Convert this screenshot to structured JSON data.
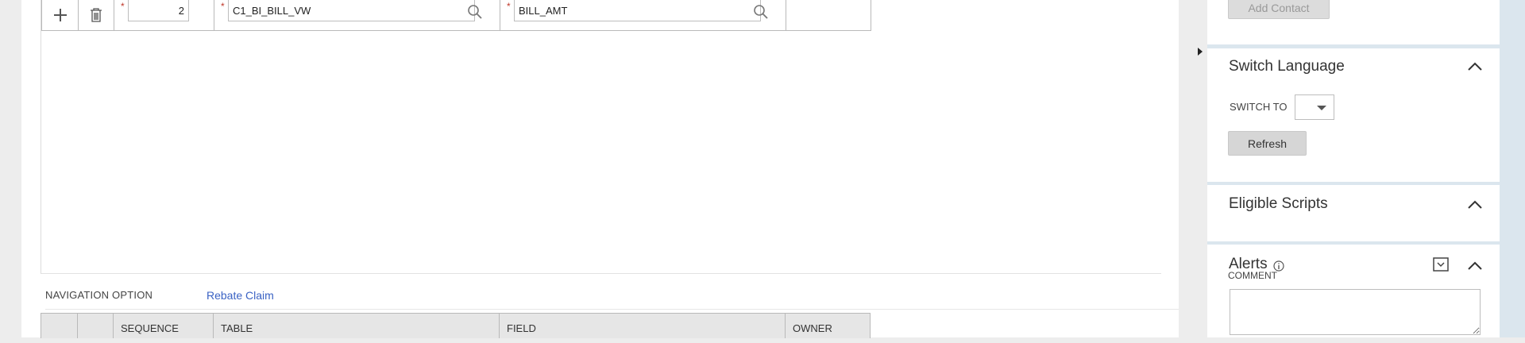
{
  "grid": {
    "row": {
      "add_icon": "plus-icon",
      "delete_icon": "trash-icon",
      "sequence": "2",
      "table": "C1_BI_BILL_VW",
      "field": "BILL_AMT",
      "required_mark": "*"
    },
    "headers": [
      "",
      "",
      "SEQUENCE",
      "TABLE",
      "FIELD",
      "OWNER"
    ]
  },
  "navigation": {
    "label": "NAVIGATION OPTION",
    "link": "Rebate Claim"
  },
  "sidebar": {
    "add_contact_label": "Add Contact",
    "switch_language": {
      "title": "Switch Language",
      "switch_to_label": "SWITCH TO",
      "selected": "",
      "refresh_label": "Refresh"
    },
    "eligible_scripts": {
      "title": "Eligible Scripts"
    },
    "alerts": {
      "title": "Alerts",
      "comment_label": "COMMENT",
      "comment_value": ""
    }
  },
  "colors": {
    "link": "#3b63c4",
    "required": "#c0392b",
    "sidebar_bg": "#dbe6ee",
    "button_bg": "#d6d6d6"
  }
}
